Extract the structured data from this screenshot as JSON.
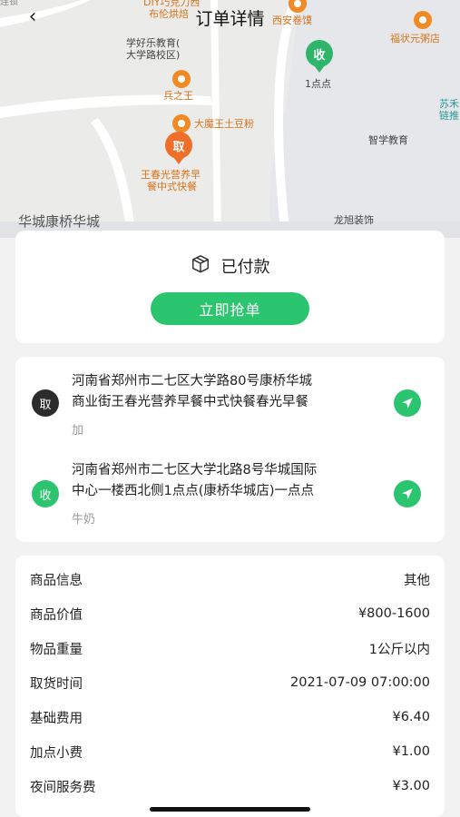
{
  "header": {
    "title": "订单详情",
    "back_icon": "‹"
  },
  "map": {
    "labels": {
      "diy": "DIY巧克力西",
      "bulun": "布伦烘焙",
      "xian": "西安卷馍",
      "fuzhuang": "福状元粥店",
      "school": "学好乐教育(",
      "school2": "大学路校区)",
      "shou_shop": "1点点",
      "bing": "兵之王",
      "sumai": "苏禾",
      "sumai2": "链推",
      "damo": "大魔王土豆粉",
      "zhixue": "智学教育",
      "wang1": "王春光营养早",
      "wang2": "餐中式快餐",
      "longxu": "龙旭装饰",
      "area": "华城康桥华城",
      "corner": "连锁"
    },
    "pick_marker": "取",
    "recv_marker": "收"
  },
  "status": {
    "text": "已付款",
    "icon": "box-icon",
    "grab_button": "立即抢单"
  },
  "pickup": {
    "badge": "取",
    "address_line1": "河南省郑州市二七区大学路80号康桥华城",
    "address_line2": "商业街王春光营养早餐中式快餐春光早餐",
    "note": "加"
  },
  "receive": {
    "badge": "收",
    "address_line1": "河南省郑州市二七区大学北路8号华城国际",
    "address_line2": "中心一楼西北侧1点点(康桥华城店)一点点",
    "note": "牛奶"
  },
  "info": [
    {
      "label": "商品信息",
      "value": "其他"
    },
    {
      "label": "商品价值",
      "value": "¥800-1600"
    },
    {
      "label": "物品重量",
      "value": "1公斤以内"
    },
    {
      "label": "取货时间",
      "value": "2021-07-09 07:00:00"
    },
    {
      "label": "基础费用",
      "value": "¥6.40"
    },
    {
      "label": "加点小费",
      "value": "¥1.00"
    },
    {
      "label": "夜间服务费",
      "value": "¥3.00"
    }
  ],
  "colors": {
    "accent": "#2cc56f",
    "pick_badge": "#2c2c2c",
    "map_marker_pick": "#ef6f2a"
  }
}
